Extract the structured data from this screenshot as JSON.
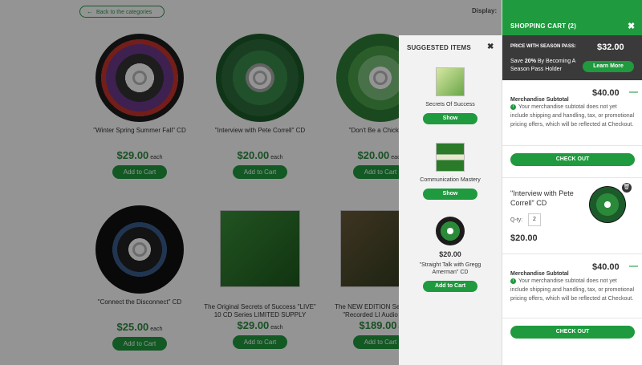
{
  "catalog": {
    "back_label": "Back to the categories",
    "display_label": "Display:",
    "products": [
      {
        "title": "\"Winter Spring Summer Fall\" CD",
        "price": "$29.00",
        "each": "each",
        "button": "Add to Cart"
      },
      {
        "title": "\"Interview with Pete Correll\" CD",
        "price": "$20.00",
        "each": "each",
        "button": "Add to Cart"
      },
      {
        "title": "\"Don't Be a Chicken S",
        "price": "$20.00",
        "each": "each",
        "button": "Add to Cart"
      },
      {
        "title": "\"Connect the Disconnect\" CD",
        "price": "$25.00",
        "each": "each",
        "button": "Add to Cart"
      },
      {
        "title": "The Original Secrets of Success \"LIVE\" 10 CD Series LIMITED SUPPLY",
        "price": "$29.00",
        "each": "each",
        "button": "Add to Cart"
      },
      {
        "title": "The NEW EDITION Se Success \"Recorded LI Audio Series",
        "price": "$189.00",
        "each": "e",
        "button": "Add to Cart"
      }
    ]
  },
  "suggested": {
    "title": "SUGGESTED ITEMS",
    "close": "✖",
    "items": [
      {
        "name": "Secrets Of Success",
        "button": "Show"
      },
      {
        "name": "Communication Mastery",
        "button": "Show"
      },
      {
        "price": "$20.00",
        "name": "\"Straight Talk with Gregg Amerman\" CD",
        "button": "Add to Cart"
      }
    ]
  },
  "cart": {
    "title": "SHOPPING CART (2)",
    "close": "✖",
    "season_pass": {
      "label": "PRICE WITH SEASON PASS:",
      "price": "$32.00",
      "save_prefix": "Save ",
      "save_pct": "20%",
      "save_suffix": " By Becoming A Season Pass Holder",
      "button": "Learn More"
    },
    "subtotal_1": {
      "label": "Merchandise Subtotal",
      "value": "$40.00",
      "toggle": "—",
      "note": "Your merchandise subtotal does not yet include shipping and handling, tax, or promotional pricing offers, which will be reflected at Checkout."
    },
    "checkout_1": "CHECK OUT",
    "item": {
      "title": "\"Interview with Pete Correll\" CD",
      "qty_label": "Q-ty:",
      "qty": "2",
      "price": "$20.00"
    },
    "subtotal_2": {
      "label": "Merchandise Subtotal",
      "value": "$40.00",
      "toggle": "—",
      "note": "Your merchandise subtotal does not yet include shipping and handling, tax, or promotional pricing offers, which will be reflected at Checkout."
    },
    "checkout_2": "CHECK OUT"
  },
  "colors": {
    "accent": "#1f9a3e",
    "dark": "#3a3a3a"
  },
  "icons": [
    "arrow-left-icon",
    "close-icon",
    "info-icon",
    "trash-icon"
  ]
}
